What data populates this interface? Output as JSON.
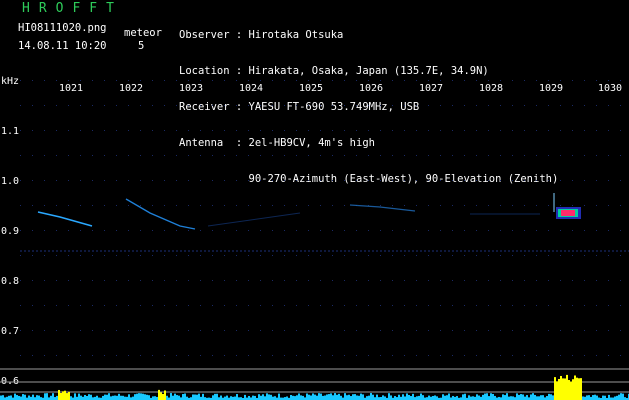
{
  "app": {
    "title": "HROFFT",
    "file": "HI08111020.png",
    "datetime": "14.08.11 10:20",
    "meteor_label": "meteor",
    "meteor_count": "5"
  },
  "info": {
    "observer": "Observer : Hirotaka Otsuka",
    "location": "Location : Hirakata, Osaka, Japan (135.7E, 34.9N)",
    "receiver": "Receiver : YAESU FT-690 53.749MHz, USB",
    "antenna": "Antenna  : 2el-HB9CV, 4m's high",
    "antenna2": "           90-270-Azimuth (East-West), 90-Elevation (Zenith)"
  },
  "axes": {
    "y_unit": "kHz",
    "x_ticks": [
      "1021",
      "1022",
      "1023",
      "1024",
      "1025",
      "1026",
      "1027",
      "1028",
      "1029",
      "1030"
    ],
    "y_ticks": [
      "1.1",
      "1.0",
      "0.9",
      "0.8",
      "0.7",
      "0.6"
    ]
  },
  "colors": {
    "title": "#2ecc5a",
    "text": "#ffffff",
    "grid_dot": "#1a2a66",
    "trail": "#2aa8ff",
    "echo_hot": "#ff2b6a",
    "spectrum": "#18c8ff",
    "spectrum_peak": "#ffff00"
  }
}
